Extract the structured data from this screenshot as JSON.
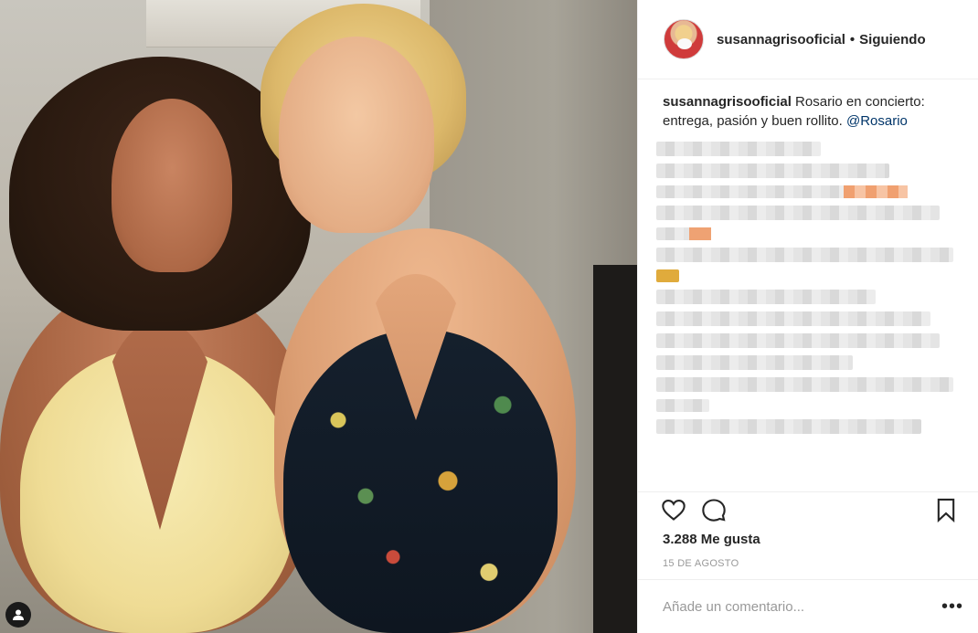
{
  "header": {
    "username": "susannagrisooficial",
    "separator": "•",
    "follow_state": "Siguiendo"
  },
  "caption": {
    "username": "susannagrisooficial",
    "text": "Rosario en concierto: entrega, pasión y buen rollito.",
    "mention": "@Rosario"
  },
  "actions": {
    "like_icon": "heart-icon",
    "comment_icon": "comment-icon",
    "save_icon": "bookmark-icon"
  },
  "likes": "3.288 Me gusta",
  "date": "15 DE AGOSTO",
  "comment_box": {
    "placeholder": "Añade un comentario...",
    "more_label": "•••"
  },
  "colors": {
    "text": "#262626",
    "muted": "#999999",
    "mention": "#003569",
    "border": "#efefef"
  }
}
